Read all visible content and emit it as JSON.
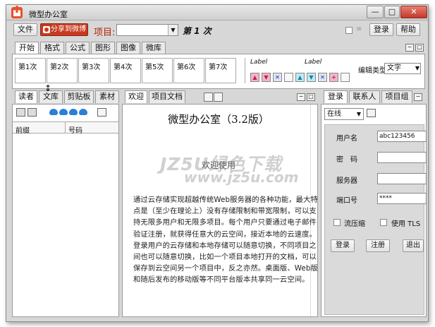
{
  "window": {
    "title": "微型办公室"
  },
  "titlebar": {
    "min": "—",
    "max": "□",
    "close": "✕"
  },
  "menu": {
    "file": "文件",
    "share": "分享到微博",
    "project_label": "项目:",
    "project_value": "",
    "iteration_label": "第 1 次",
    "login": "登录",
    "help": "帮助"
  },
  "main_tabs": [
    "开始",
    "格式",
    "公式",
    "图形",
    "图像",
    "微库"
  ],
  "ribbon": {
    "iterations": [
      "第1次",
      "第2次",
      "第3次",
      "第4次",
      "第5次",
      "第6次",
      "第7次"
    ],
    "label1": "Label",
    "label2": "Label",
    "edit_type_label": "编辑类型",
    "edit_type_value": "文字"
  },
  "left_panel": {
    "tabs": [
      "读者",
      "文库",
      "剪贴板",
      "素材"
    ],
    "columns": [
      "前缀",
      "号码"
    ]
  },
  "center_panel": {
    "tabs": [
      "欢迎",
      "项目文档"
    ],
    "heading": "微型办公室（3.2版）",
    "subheading": "欢迎使用",
    "body": "通过云存储实现超越传统Web服务器的各种功能，最大特点是（至少在理论上）没有存储限制和带宽限制，可以支持无限多用户和无限多项目。每个用户只要通过电子邮件验证注册，就获得任意大的云空间，接近本地的云速度。登录用户的云存储和本地存储可以随意切换，不同项目之间也可以随意切换，比如一个项目本地打开的文档，可以保存到云空间另一个项目中，反之亦然。桌面版、Web版和随后发布的移动版等不同平台版本共享同一云空间。",
    "watermark": "JZ5U绿色下载",
    "watermark_url": "www.jz5u.com"
  },
  "right_panel": {
    "tabs": [
      "登录",
      "联系人",
      "项目组"
    ],
    "status": "在线",
    "fields": [
      {
        "label": "用户名",
        "value": "abc123456"
      },
      {
        "label": "密　码",
        "value": ""
      },
      {
        "label": "服务器",
        "value": ""
      },
      {
        "label": "端口号",
        "value": "****"
      }
    ],
    "compress": "流压缩",
    "use_tls": "使用 TLS",
    "buttons": [
      "登录",
      "注册",
      "退出"
    ]
  },
  "colors": {
    "share": "#c83a1e",
    "project_label": "#b5220c",
    "cloud": "#2a7fd6"
  }
}
